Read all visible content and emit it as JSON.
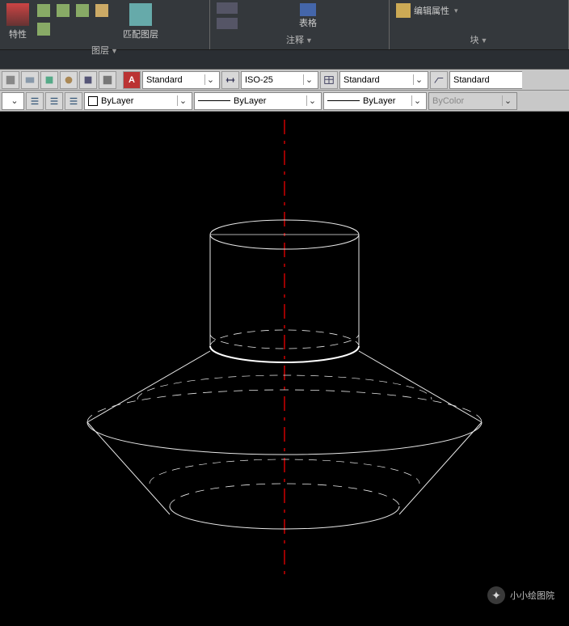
{
  "ribbon": {
    "panels": [
      {
        "buttons": [
          "特性"
        ],
        "mini": [
          "a",
          "b",
          "c",
          "d",
          "e"
        ],
        "big_right": "匹配图层",
        "title": "图层"
      },
      {
        "mini": [
          "表格"
        ],
        "title": "注释",
        "left_big": [
          "a",
          "b"
        ]
      },
      {
        "big": "编辑属性",
        "title": "块"
      }
    ]
  },
  "toolbar": {
    "style1": "Standard",
    "dim": "ISO-25",
    "style2": "Standard",
    "style3": "Standard",
    "layer": "ByLayer",
    "ltype": "ByLayer",
    "lweight": "ByLayer",
    "color": "ByColor"
  },
  "watermark": "小小绘图院"
}
